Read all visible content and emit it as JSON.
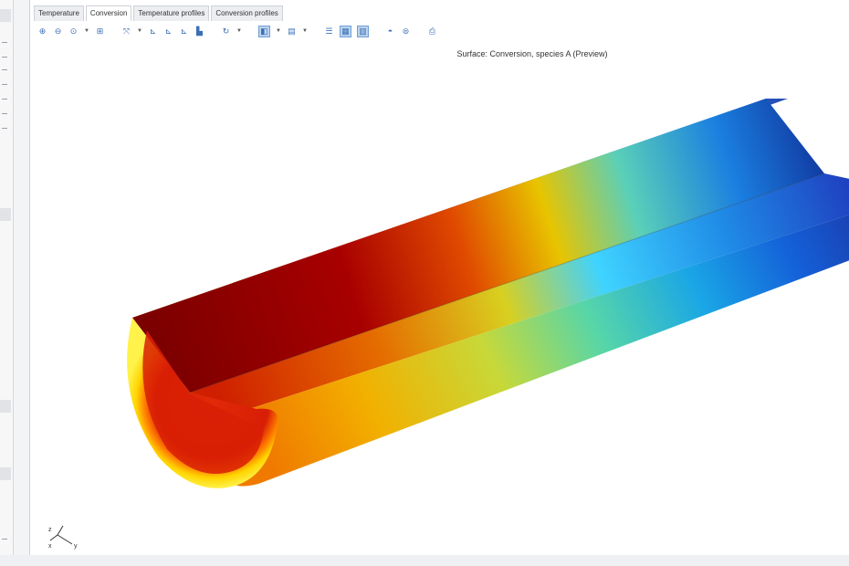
{
  "tabs": [
    {
      "label": "Temperature",
      "active": false
    },
    {
      "label": "Conversion",
      "active": true
    },
    {
      "label": "Temperature profiles",
      "active": false
    },
    {
      "label": "Conversion profiles",
      "active": false
    }
  ],
  "toolbar": {
    "icons": [
      "zoom-in-icon",
      "zoom-out-icon",
      "zoom-box-icon",
      "zoom-extents-icon",
      "pan-icon",
      "view-xy-icon",
      "view-yz-icon",
      "view-zx-icon",
      "view-3d-icon",
      "rotate-icon",
      "transparency-icon",
      "wireframe-icon",
      "grid-icon",
      "lights-icon",
      "scene-icon",
      "camera-icon",
      "print-icon"
    ]
  },
  "plot": {
    "title": "Surface: Conversion, species A (Preview)"
  },
  "axes": {
    "x": "x",
    "y": "y",
    "z": "z"
  },
  "colors": {
    "colormap": [
      "#7f0000",
      "#d81e05",
      "#ffbf00",
      "#ffff00",
      "#7fff7f",
      "#00bfff",
      "#0050ff",
      "#00007f"
    ]
  }
}
